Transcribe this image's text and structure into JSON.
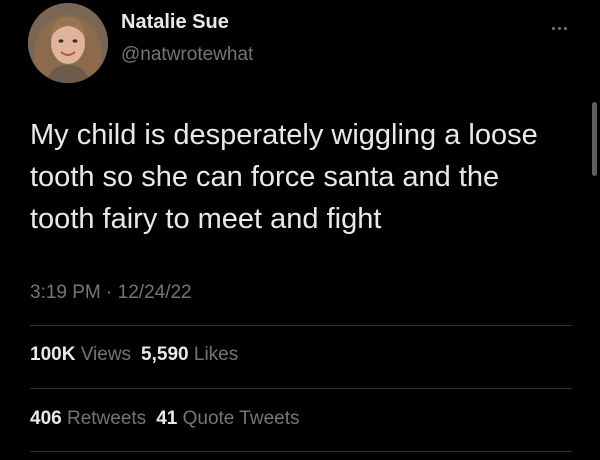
{
  "author": {
    "display_name": "Natalie Sue",
    "handle": "@natwrotewhat"
  },
  "more_icon": "more-horizontal-icon",
  "tweet": {
    "text": "My child is desperately wiggling a loose tooth so she can force santa and the tooth fairy to meet and fight",
    "time": "3:19 PM",
    "separator": " · ",
    "date": "12/24/22"
  },
  "stats": {
    "views": {
      "value": "100K",
      "label": "Views"
    },
    "likes": {
      "value": "5,590",
      "label": "Likes"
    },
    "retweets": {
      "value": "406",
      "label": "Retweets"
    },
    "quote_tweets": {
      "value": "41",
      "label": "Quote Tweets"
    }
  },
  "colors": {
    "background": "#000000",
    "primary_text": "#e7e9ea",
    "secondary_text": "#71767b",
    "divider": "#2f3336"
  }
}
